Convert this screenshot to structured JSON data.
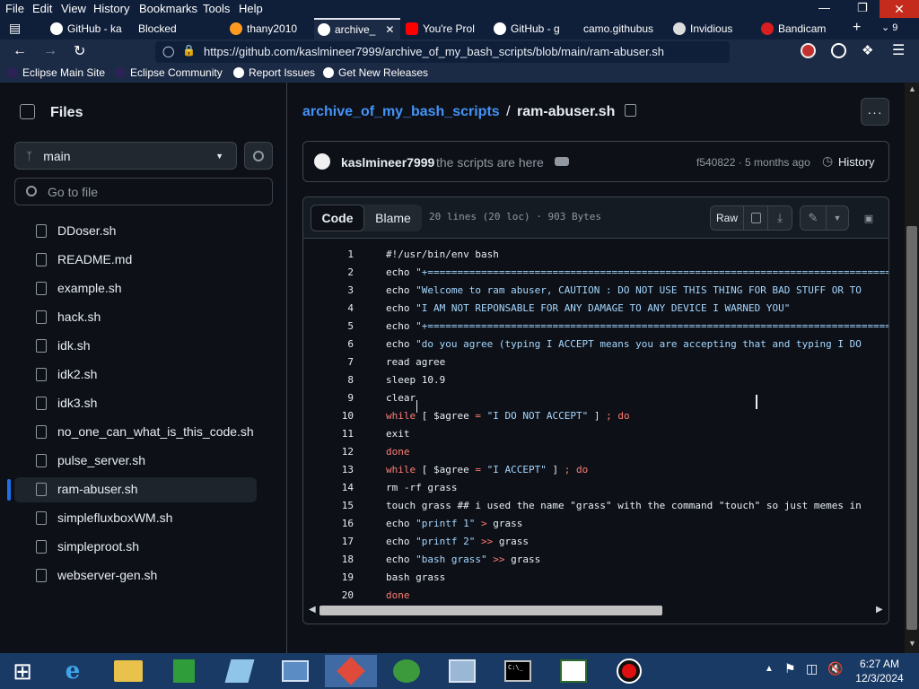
{
  "menubar": {
    "items": [
      "File",
      "Edit",
      "View",
      "History",
      "Bookmarks",
      "Tools",
      "Help"
    ]
  },
  "tabs": [
    {
      "label": "GitHub - ka",
      "active": false
    },
    {
      "label": "Blocked",
      "active": false
    },
    {
      "label": "thany2010",
      "active": false
    },
    {
      "label": "archive_",
      "active": true
    },
    {
      "label": "You're Prol",
      "active": false
    },
    {
      "label": "GitHub - g",
      "active": false
    },
    {
      "label": "camo.githubus",
      "active": false
    },
    {
      "label": "Invidious",
      "active": false
    },
    {
      "label": "Bandicam",
      "active": false
    }
  ],
  "tab_overflow_count": "9",
  "url": "https://github.com/kaslmineer7999/archive_of_my_bash_scripts/blob/main/ram-abuser.sh",
  "bookmarks": [
    "Eclipse Main Site",
    "Eclipse Community",
    "Report Issues",
    "Get New Releases"
  ],
  "sidebar": {
    "title": "Files",
    "branch": "main",
    "goto_placeholder": "Go to file",
    "files": [
      "DDoser.sh",
      "README.md",
      "example.sh",
      "hack.sh",
      "idk.sh",
      "idk2.sh",
      "idk3.sh",
      "no_one_can_what_is_this_code.sh",
      "pulse_server.sh",
      "ram-abuser.sh",
      "simplefluxboxWM.sh",
      "simpleproot.sh",
      "webserver-gen.sh"
    ],
    "selected_index": 9
  },
  "breadcrumb": {
    "repo": "archive_of_my_bash_scripts",
    "separator": "/",
    "file": "ram-abuser.sh"
  },
  "commit": {
    "author": "kaslmineer7999",
    "message": "the scripts are here",
    "hash_time": "f540822 · 5 months ago",
    "history_label": "History"
  },
  "toolbar": {
    "code_tab": "Code",
    "blame_tab": "Blame",
    "file_info": "20 lines (20 loc) · 903 Bytes",
    "raw_label": "Raw"
  },
  "code": [
    {
      "n": "1",
      "parts": [
        [
          "",
          "#!/usr/bin/env bash"
        ]
      ]
    },
    {
      "n": "2",
      "parts": [
        [
          "",
          "echo "
        ],
        [
          "str",
          "\"+=====================================================================================\""
        ]
      ]
    },
    {
      "n": "3",
      "parts": [
        [
          "",
          "echo "
        ],
        [
          "str",
          "\"Welcome to ram abuser, CAUTION : DO NOT USE THIS THING FOR BAD STUFF OR TO"
        ]
      ]
    },
    {
      "n": "4",
      "parts": [
        [
          "",
          "echo "
        ],
        [
          "str",
          "\"I AM NOT REPONSABLE FOR ANY DAMAGE TO ANY DEVICE I WARNED YOU\""
        ]
      ]
    },
    {
      "n": "5",
      "parts": [
        [
          "",
          "echo "
        ],
        [
          "str",
          "\"+=====================================================================================\""
        ]
      ]
    },
    {
      "n": "6",
      "parts": [
        [
          "",
          "echo "
        ],
        [
          "str",
          "\"do you agree (typing I ACCEPT means you are accepting that and typing I DO"
        ]
      ]
    },
    {
      "n": "7",
      "parts": [
        [
          "",
          "read agree"
        ]
      ]
    },
    {
      "n": "8",
      "parts": [
        [
          "",
          "sleep 10.9"
        ]
      ]
    },
    {
      "n": "9",
      "parts": [
        [
          "",
          "clear"
        ]
      ]
    },
    {
      "n": "10",
      "parts": [
        [
          "kw",
          "while"
        ],
        [
          "",
          " [ $agree "
        ],
        [
          "kw",
          "="
        ],
        [
          "",
          " "
        ],
        [
          "str",
          "\"I DO NOT ACCEPT\""
        ],
        [
          "",
          " ] "
        ],
        [
          "kw",
          ";"
        ],
        [
          "",
          " "
        ],
        [
          "kw",
          "do"
        ]
      ]
    },
    {
      "n": "11",
      "parts": [
        [
          "",
          "exit"
        ]
      ]
    },
    {
      "n": "12",
      "parts": [
        [
          "kw",
          "done"
        ]
      ]
    },
    {
      "n": "13",
      "parts": [
        [
          "kw",
          "while"
        ],
        [
          "",
          " [ $agree "
        ],
        [
          "kw",
          "="
        ],
        [
          "",
          " "
        ],
        [
          "str",
          "\"I ACCEPT\""
        ],
        [
          "",
          " ] "
        ],
        [
          "kw",
          ";"
        ],
        [
          "",
          " "
        ],
        [
          "kw",
          "do"
        ]
      ]
    },
    {
      "n": "14",
      "parts": [
        [
          "",
          "rm -rf grass"
        ]
      ]
    },
    {
      "n": "15",
      "parts": [
        [
          "",
          "touch grass ## i used the name \"grass\" with the command \"touch\" so just memes in"
        ]
      ]
    },
    {
      "n": "16",
      "parts": [
        [
          "",
          "echo "
        ],
        [
          "str",
          "\"printf 1\""
        ],
        [
          "",
          " "
        ],
        [
          "kw",
          ">"
        ],
        [
          "",
          " grass"
        ]
      ]
    },
    {
      "n": "17",
      "parts": [
        [
          "",
          "echo "
        ],
        [
          "str",
          "\"printf 2\""
        ],
        [
          "",
          " "
        ],
        [
          "kw",
          ">>"
        ],
        [
          "",
          " grass"
        ]
      ]
    },
    {
      "n": "18",
      "parts": [
        [
          "",
          "echo "
        ],
        [
          "str",
          "\"bash grass\""
        ],
        [
          "",
          " "
        ],
        [
          "kw",
          ">>"
        ],
        [
          "",
          " grass"
        ]
      ]
    },
    {
      "n": "19",
      "parts": [
        [
          "",
          "bash grass"
        ]
      ]
    },
    {
      "n": "20",
      "parts": [
        [
          "kw",
          "done"
        ]
      ]
    }
  ],
  "clock": {
    "time": "6:27 AM",
    "date": "12/3/2024"
  },
  "colors": {
    "link": "#4493f8",
    "keyword": "#ff7b72",
    "string": "#a5d6ff",
    "selected_bar": "#1f6feb"
  }
}
